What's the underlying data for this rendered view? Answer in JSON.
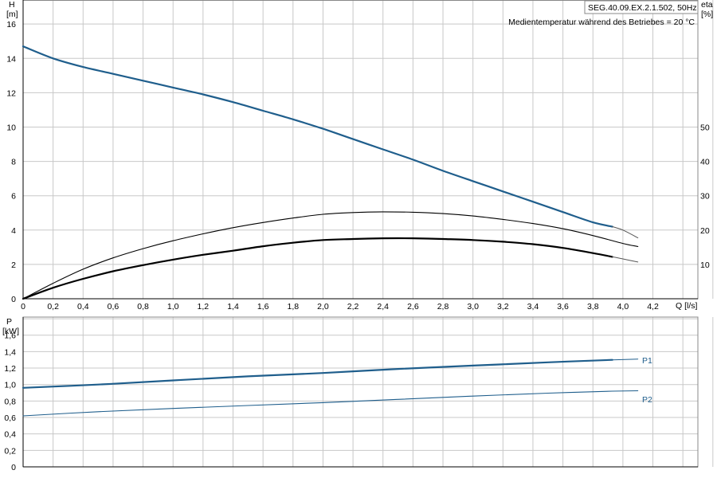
{
  "colors": {
    "grid": "#c8c8c8",
    "frame": "#888888",
    "head_curve": "#1f5e8c",
    "power_curve": "#1f5e8c",
    "efficiency_curve": "#000000",
    "power_label": "#1f5e8c"
  },
  "header": {
    "model": "SEG.40.09.EX.2.1.502, 50Hz",
    "temperature_note": "Medientemperatur während des Betriebes = 20 °C"
  },
  "chart_data": [
    {
      "type": "line",
      "x_label": "Q [l/s]",
      "x_range": [
        0,
        4.5
      ],
      "x_ticks": [
        "0",
        "0,2",
        "0,4",
        "0,6",
        "0,8",
        "1,0",
        "1,2",
        "1,4",
        "1,6",
        "1,8",
        "2,0",
        "2,2",
        "2,4",
        "2,6",
        "2,8",
        "3,0",
        "3,2",
        "3,4",
        "3,6",
        "3,8",
        "4,0",
        "4,2"
      ],
      "y_left_label_line1": "H",
      "y_left_label_line2": "[m]",
      "y_left_range": [
        0,
        17.4
      ],
      "y_left_ticks": [
        "0",
        "2",
        "4",
        "6",
        "8",
        "10",
        "12",
        "14",
        "16"
      ],
      "y_right_label_line1": "eta",
      "y_right_label_line2": "[%]",
      "y_right_range": [
        0,
        87
      ],
      "y_right_ticks": [
        "10",
        "20",
        "30",
        "40",
        "50"
      ],
      "grid": true,
      "series": [
        {
          "role": "head",
          "axis": "left",
          "x": [
            0,
            0.2,
            0.4,
            0.6,
            0.8,
            1.0,
            1.2,
            1.4,
            1.6,
            1.8,
            2.0,
            2.2,
            2.4,
            2.6,
            2.8,
            3.0,
            3.2,
            3.4,
            3.6,
            3.8,
            3.93
          ],
          "y": [
            14.7,
            14.0,
            13.5,
            13.1,
            12.7,
            12.3,
            11.9,
            11.45,
            10.95,
            10.45,
            9.9,
            9.3,
            8.7,
            8.1,
            7.45,
            6.85,
            6.25,
            5.65,
            5.05,
            4.45,
            4.2
          ]
        },
        {
          "role": "head-extension",
          "axis": "left",
          "x": [
            3.93,
            4.0,
            4.1
          ],
          "y": [
            4.2,
            4.0,
            3.55
          ]
        },
        {
          "role": "efficiency-thin",
          "axis": "right",
          "x": [
            0,
            0.2,
            0.4,
            0.6,
            0.8,
            1.0,
            1.2,
            1.4,
            1.6,
            1.8,
            2.0,
            2.2,
            2.4,
            2.6,
            2.8,
            3.0,
            3.2,
            3.4,
            3.6,
            3.8,
            4.0,
            4.1
          ],
          "y": [
            0,
            4.5,
            8.6,
            11.9,
            14.6,
            16.9,
            18.9,
            20.7,
            22.2,
            23.5,
            24.6,
            25.1,
            25.3,
            25.2,
            24.8,
            24.1,
            23.1,
            21.9,
            20.4,
            18.4,
            16.1,
            15.2
          ]
        },
        {
          "role": "efficiency-thick",
          "axis": "right",
          "x": [
            0,
            0.2,
            0.4,
            0.6,
            0.8,
            1.0,
            1.2,
            1.4,
            1.6,
            1.8,
            2.0,
            2.2,
            2.4,
            2.6,
            2.8,
            3.0,
            3.2,
            3.4,
            3.6,
            3.8,
            3.93
          ],
          "y": [
            0,
            3.2,
            5.8,
            8.0,
            9.8,
            11.4,
            12.8,
            14.0,
            15.3,
            16.3,
            17.1,
            17.4,
            17.6,
            17.6,
            17.4,
            17.1,
            16.6,
            15.9,
            14.8,
            13.3,
            12.2
          ]
        },
        {
          "role": "efficiency-thick-extension",
          "axis": "right",
          "x": [
            3.93,
            4.0,
            4.1
          ],
          "y": [
            12.2,
            11.6,
            10.7
          ]
        }
      ]
    },
    {
      "type": "line",
      "x_range": [
        0,
        4.5
      ],
      "y_label_line1": "P",
      "y_label_line2": "[kW]",
      "y_range": [
        0,
        1.82
      ],
      "y_ticks": [
        "0",
        "0,2",
        "0,4",
        "0,6",
        "0,8",
        "1,0",
        "1,2",
        "1,4",
        "1,6"
      ],
      "grid": true,
      "series": [
        {
          "name": "P1",
          "x": [
            0,
            0.5,
            1.0,
            1.5,
            2.0,
            2.5,
            3.0,
            3.5,
            3.93
          ],
          "y": [
            0.96,
            1.0,
            1.05,
            1.1,
            1.14,
            1.19,
            1.23,
            1.27,
            1.3
          ]
        },
        {
          "name": "P1-extension",
          "x": [
            3.93,
            4.1
          ],
          "y": [
            1.3,
            1.31
          ]
        },
        {
          "name": "P2",
          "x": [
            0,
            0.5,
            1.0,
            1.5,
            2.0,
            2.5,
            3.0,
            3.5,
            3.93
          ],
          "y": [
            0.62,
            0.67,
            0.71,
            0.745,
            0.78,
            0.82,
            0.86,
            0.895,
            0.92
          ]
        },
        {
          "name": "P2-extension",
          "x": [
            3.93,
            4.1
          ],
          "y": [
            0.92,
            0.925
          ]
        }
      ]
    }
  ]
}
